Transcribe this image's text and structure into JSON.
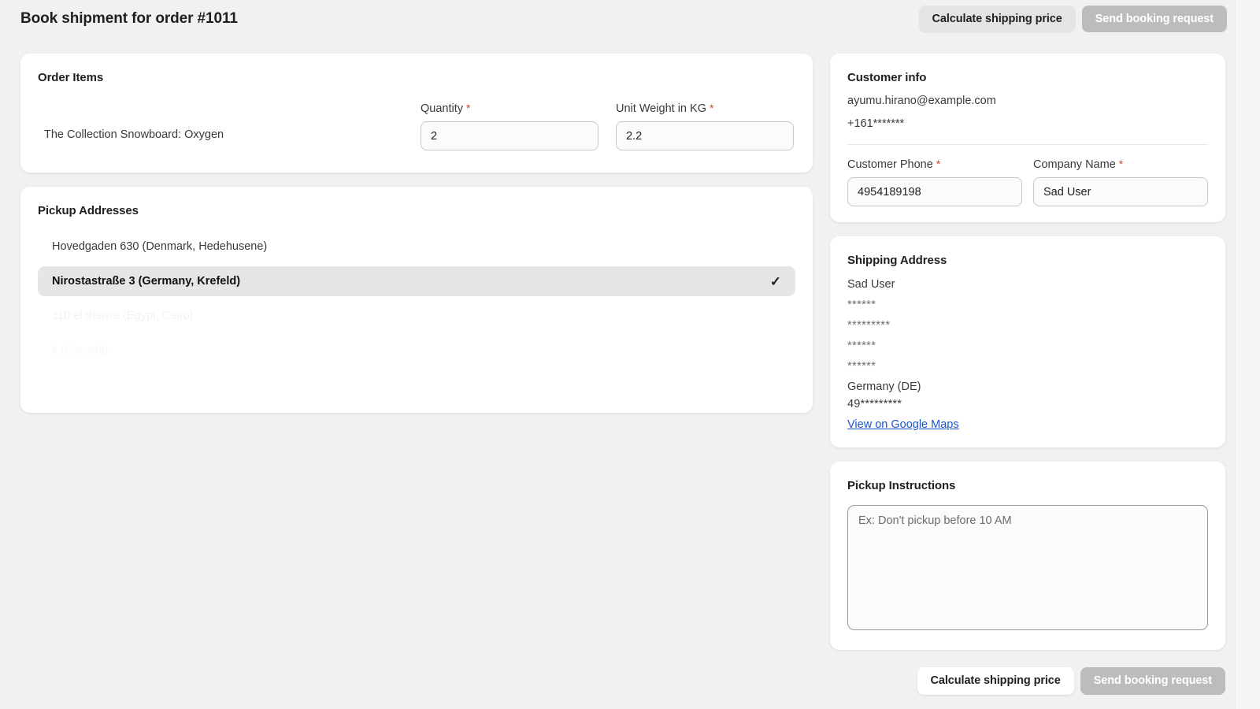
{
  "header": {
    "title": "Book shipment for order #1011",
    "calculate_label": "Calculate shipping price",
    "send_label": "Send booking request"
  },
  "order_items": {
    "title": "Order Items",
    "item_name": "The Collection Snowboard: Oxygen",
    "quantity": {
      "label": "Quantity",
      "required_mark": "*",
      "value": "2"
    },
    "unit_weight": {
      "label": "Unit Weight in KG",
      "required_mark": "*",
      "value": "2.2"
    }
  },
  "pickup_addresses": {
    "title": "Pickup Addresses",
    "check_glyph": "✓",
    "items": [
      {
        "label": "Hovedgaden 630 (Denmark, Hedehusene)",
        "selected": false
      },
      {
        "label": "Nirostastraße 3 (Germany, Krefeld)",
        "selected": true
      },
      {
        "label": "110 el thawra (Egypt, Cairo)",
        "selected": false
      },
      {
        "label": "k (Canada)",
        "selected": false
      }
    ]
  },
  "customer_info": {
    "title": "Customer info",
    "email": "ayumu.hirano@example.com",
    "phone_masked": "+161*******",
    "customer_phone": {
      "label": "Customer Phone",
      "required_mark": "*",
      "value": "4954189198"
    },
    "company_name": {
      "label": "Company Name",
      "required_mark": "*",
      "value": "Sad User"
    }
  },
  "shipping_address": {
    "title": "Shipping Address",
    "name": "Sad User",
    "line1": "******",
    "line2": "*********",
    "line3": "******",
    "line4": "******",
    "country": "Germany (DE)",
    "phone": "49*********",
    "map_link": "View on Google Maps"
  },
  "pickup_instructions": {
    "title": "Pickup Instructions",
    "placeholder": "Ex: Don't pickup before 10 AM",
    "value": ""
  },
  "footer": {
    "calculate_label": "Calculate shipping price",
    "send_label": "Send booking request"
  },
  "colors": {
    "page_background": "#f1f1f1",
    "card_background": "#ffffff",
    "required_asterisk": "#c9462c",
    "link": "#1a55d0",
    "selected_row": "#e6e6e6",
    "disabled_button": "#bcbcbc"
  }
}
